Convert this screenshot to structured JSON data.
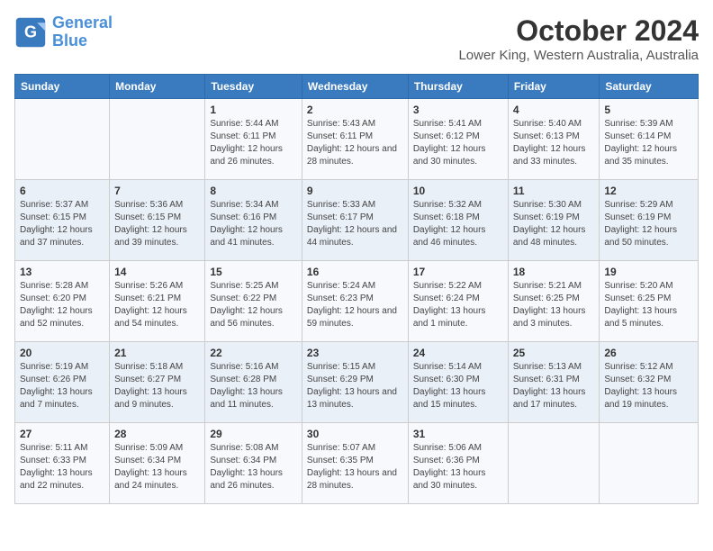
{
  "logo": {
    "line1": "General",
    "line2": "Blue"
  },
  "title": "October 2024",
  "subtitle": "Lower King, Western Australia, Australia",
  "days_header": [
    "Sunday",
    "Monday",
    "Tuesday",
    "Wednesday",
    "Thursday",
    "Friday",
    "Saturday"
  ],
  "weeks": [
    [
      {
        "day": "",
        "sunrise": "",
        "sunset": "",
        "daylight": ""
      },
      {
        "day": "",
        "sunrise": "",
        "sunset": "",
        "daylight": ""
      },
      {
        "day": "1",
        "sunrise": "Sunrise: 5:44 AM",
        "sunset": "Sunset: 6:11 PM",
        "daylight": "Daylight: 12 hours and 26 minutes."
      },
      {
        "day": "2",
        "sunrise": "Sunrise: 5:43 AM",
        "sunset": "Sunset: 6:11 PM",
        "daylight": "Daylight: 12 hours and 28 minutes."
      },
      {
        "day": "3",
        "sunrise": "Sunrise: 5:41 AM",
        "sunset": "Sunset: 6:12 PM",
        "daylight": "Daylight: 12 hours and 30 minutes."
      },
      {
        "day": "4",
        "sunrise": "Sunrise: 5:40 AM",
        "sunset": "Sunset: 6:13 PM",
        "daylight": "Daylight: 12 hours and 33 minutes."
      },
      {
        "day": "5",
        "sunrise": "Sunrise: 5:39 AM",
        "sunset": "Sunset: 6:14 PM",
        "daylight": "Daylight: 12 hours and 35 minutes."
      }
    ],
    [
      {
        "day": "6",
        "sunrise": "Sunrise: 5:37 AM",
        "sunset": "Sunset: 6:15 PM",
        "daylight": "Daylight: 12 hours and 37 minutes."
      },
      {
        "day": "7",
        "sunrise": "Sunrise: 5:36 AM",
        "sunset": "Sunset: 6:15 PM",
        "daylight": "Daylight: 12 hours and 39 minutes."
      },
      {
        "day": "8",
        "sunrise": "Sunrise: 5:34 AM",
        "sunset": "Sunset: 6:16 PM",
        "daylight": "Daylight: 12 hours and 41 minutes."
      },
      {
        "day": "9",
        "sunrise": "Sunrise: 5:33 AM",
        "sunset": "Sunset: 6:17 PM",
        "daylight": "Daylight: 12 hours and 44 minutes."
      },
      {
        "day": "10",
        "sunrise": "Sunrise: 5:32 AM",
        "sunset": "Sunset: 6:18 PM",
        "daylight": "Daylight: 12 hours and 46 minutes."
      },
      {
        "day": "11",
        "sunrise": "Sunrise: 5:30 AM",
        "sunset": "Sunset: 6:19 PM",
        "daylight": "Daylight: 12 hours and 48 minutes."
      },
      {
        "day": "12",
        "sunrise": "Sunrise: 5:29 AM",
        "sunset": "Sunset: 6:19 PM",
        "daylight": "Daylight: 12 hours and 50 minutes."
      }
    ],
    [
      {
        "day": "13",
        "sunrise": "Sunrise: 5:28 AM",
        "sunset": "Sunset: 6:20 PM",
        "daylight": "Daylight: 12 hours and 52 minutes."
      },
      {
        "day": "14",
        "sunrise": "Sunrise: 5:26 AM",
        "sunset": "Sunset: 6:21 PM",
        "daylight": "Daylight: 12 hours and 54 minutes."
      },
      {
        "day": "15",
        "sunrise": "Sunrise: 5:25 AM",
        "sunset": "Sunset: 6:22 PM",
        "daylight": "Daylight: 12 hours and 56 minutes."
      },
      {
        "day": "16",
        "sunrise": "Sunrise: 5:24 AM",
        "sunset": "Sunset: 6:23 PM",
        "daylight": "Daylight: 12 hours and 59 minutes."
      },
      {
        "day": "17",
        "sunrise": "Sunrise: 5:22 AM",
        "sunset": "Sunset: 6:24 PM",
        "daylight": "Daylight: 13 hours and 1 minute."
      },
      {
        "day": "18",
        "sunrise": "Sunrise: 5:21 AM",
        "sunset": "Sunset: 6:25 PM",
        "daylight": "Daylight: 13 hours and 3 minutes."
      },
      {
        "day": "19",
        "sunrise": "Sunrise: 5:20 AM",
        "sunset": "Sunset: 6:25 PM",
        "daylight": "Daylight: 13 hours and 5 minutes."
      }
    ],
    [
      {
        "day": "20",
        "sunrise": "Sunrise: 5:19 AM",
        "sunset": "Sunset: 6:26 PM",
        "daylight": "Daylight: 13 hours and 7 minutes."
      },
      {
        "day": "21",
        "sunrise": "Sunrise: 5:18 AM",
        "sunset": "Sunset: 6:27 PM",
        "daylight": "Daylight: 13 hours and 9 minutes."
      },
      {
        "day": "22",
        "sunrise": "Sunrise: 5:16 AM",
        "sunset": "Sunset: 6:28 PM",
        "daylight": "Daylight: 13 hours and 11 minutes."
      },
      {
        "day": "23",
        "sunrise": "Sunrise: 5:15 AM",
        "sunset": "Sunset: 6:29 PM",
        "daylight": "Daylight: 13 hours and 13 minutes."
      },
      {
        "day": "24",
        "sunrise": "Sunrise: 5:14 AM",
        "sunset": "Sunset: 6:30 PM",
        "daylight": "Daylight: 13 hours and 15 minutes."
      },
      {
        "day": "25",
        "sunrise": "Sunrise: 5:13 AM",
        "sunset": "Sunset: 6:31 PM",
        "daylight": "Daylight: 13 hours and 17 minutes."
      },
      {
        "day": "26",
        "sunrise": "Sunrise: 5:12 AM",
        "sunset": "Sunset: 6:32 PM",
        "daylight": "Daylight: 13 hours and 19 minutes."
      }
    ],
    [
      {
        "day": "27",
        "sunrise": "Sunrise: 5:11 AM",
        "sunset": "Sunset: 6:33 PM",
        "daylight": "Daylight: 13 hours and 22 minutes."
      },
      {
        "day": "28",
        "sunrise": "Sunrise: 5:09 AM",
        "sunset": "Sunset: 6:34 PM",
        "daylight": "Daylight: 13 hours and 24 minutes."
      },
      {
        "day": "29",
        "sunrise": "Sunrise: 5:08 AM",
        "sunset": "Sunset: 6:34 PM",
        "daylight": "Daylight: 13 hours and 26 minutes."
      },
      {
        "day": "30",
        "sunrise": "Sunrise: 5:07 AM",
        "sunset": "Sunset: 6:35 PM",
        "daylight": "Daylight: 13 hours and 28 minutes."
      },
      {
        "day": "31",
        "sunrise": "Sunrise: 5:06 AM",
        "sunset": "Sunset: 6:36 PM",
        "daylight": "Daylight: 13 hours and 30 minutes."
      },
      {
        "day": "",
        "sunrise": "",
        "sunset": "",
        "daylight": ""
      },
      {
        "day": "",
        "sunrise": "",
        "sunset": "",
        "daylight": ""
      }
    ]
  ]
}
